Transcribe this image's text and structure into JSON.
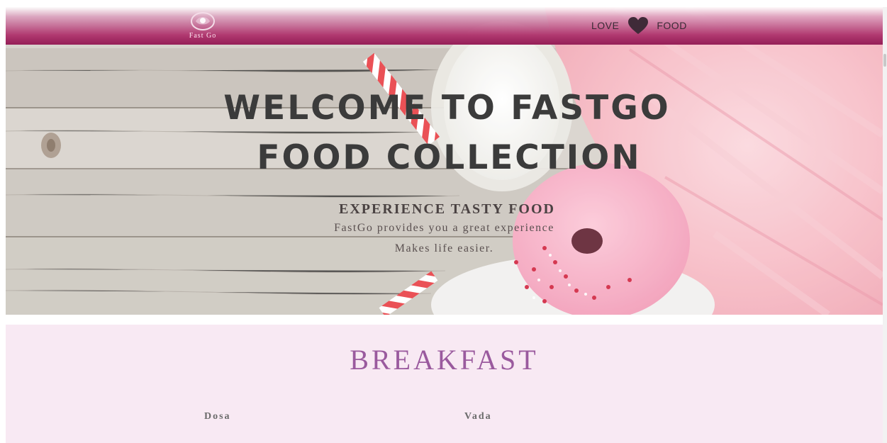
{
  "navbar": {
    "logo_text": "Fast Go",
    "love_left": "LOVE",
    "love_right": "FOOD"
  },
  "hero": {
    "title_line1": "WELCOME TO FASTGO",
    "title_line2": "FOOD COLLECTION",
    "kicker": "EXPERIENCE TASTY FOOD",
    "description": "FastGo provides you a great experience",
    "description2": "Makes life easier."
  },
  "breakfast": {
    "title": "BREAKFAST",
    "items": [
      {
        "name": "Dosa"
      },
      {
        "name": "Vada"
      }
    ]
  },
  "colors": {
    "nav_accent": "#a52a64",
    "section_bg": "#f8e9f3",
    "section_title": "#9a5a9e"
  },
  "icons": [
    "logo-icon",
    "heart-icon"
  ]
}
